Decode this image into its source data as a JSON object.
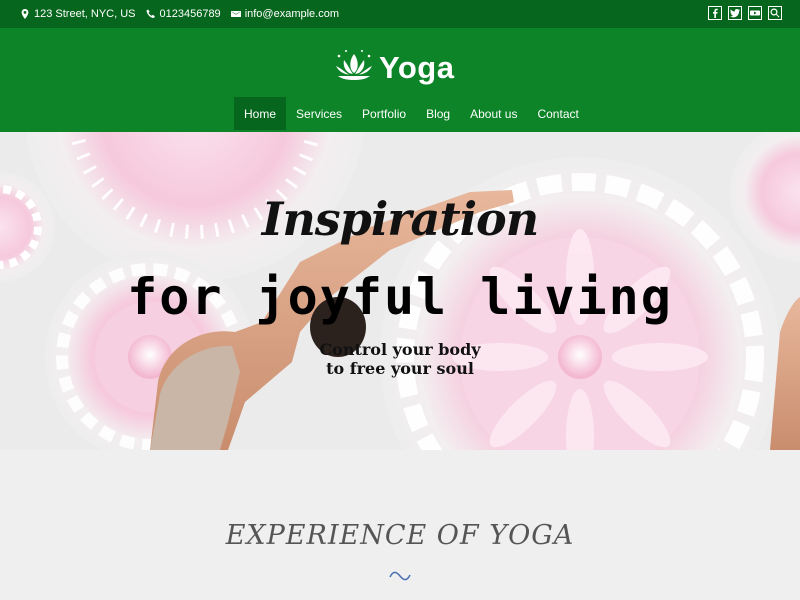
{
  "topbar": {
    "address": "123 Street, NYC, US",
    "phone": "0123456789",
    "email": "info@example.com",
    "social_icons": [
      "facebook-icon",
      "twitter-icon",
      "youtube-icon",
      "search-icon"
    ]
  },
  "header": {
    "logo_text": "Yoga",
    "nav": [
      {
        "label": "Home",
        "active": true
      },
      {
        "label": "Services"
      },
      {
        "label": "Portfolio"
      },
      {
        "label": "Blog"
      },
      {
        "label": "About us"
      },
      {
        "label": "Contact"
      }
    ]
  },
  "hero": {
    "script_title": "Inspiration",
    "main_title": "for joyful living",
    "subtitle_line1": "Control your body",
    "subtitle_line2": "to free your soul"
  },
  "section": {
    "title": "EXPERIENCE OF YOGA"
  },
  "colors": {
    "topbar": "#06661d",
    "header": "#0c8427",
    "nav_active": "#06661d",
    "section_bg": "#efefef",
    "accent": "#4a6fb5"
  }
}
